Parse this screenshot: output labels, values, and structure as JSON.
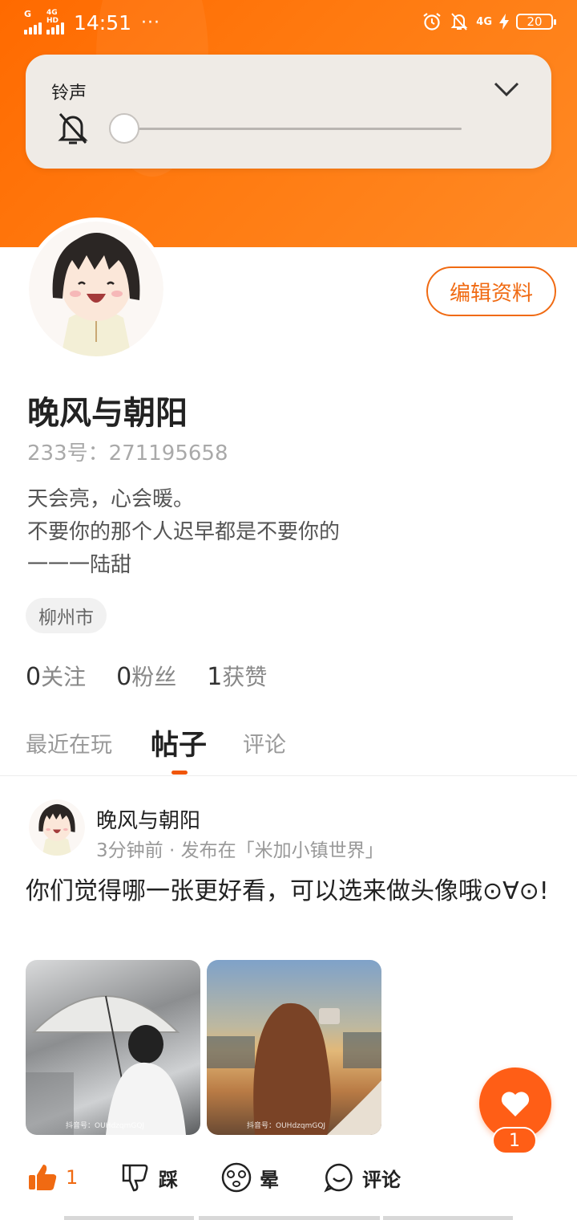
{
  "status_bar": {
    "signal1_tag": "G",
    "signal2_tag": "4G HD",
    "time": "14:51",
    "dots": "···",
    "network_right": "4G",
    "battery": "20"
  },
  "volume_panel": {
    "title": "铃声",
    "level": 0
  },
  "profile": {
    "edit_button": "编辑资料",
    "nickname": "晚风与朝阳",
    "uid_label": "233号：271195658",
    "bio_lines": [
      "天会亮，心会暖。",
      "不要你的那个人迟早都是不要你的",
      "一一一陆甜"
    ],
    "location": "柳州市",
    "stats": [
      {
        "value": "0",
        "label": "关注"
      },
      {
        "value": "0",
        "label": "粉丝"
      },
      {
        "value": "1",
        "label": "获赞"
      }
    ]
  },
  "tabs": [
    {
      "label": "最近在玩",
      "active": false
    },
    {
      "label": "帖子",
      "active": true
    },
    {
      "label": "评论",
      "active": false
    }
  ],
  "post": {
    "author": "晚风与朝阳",
    "meta": "3分钟前 · 发布在「米加小镇世界」",
    "text": "你们觉得哪一张更好看，可以选来做头像哦⊙∀⊙!",
    "images": [
      {
        "watermark": "抖音号：OUHdzqmGQJ"
      },
      {
        "watermark": "抖音号：OUHdzqmGQJ"
      }
    ],
    "actions": {
      "like_count": "1",
      "dislike": "踩",
      "dizzy": "晕",
      "comment": "评论"
    }
  },
  "fab": {
    "count": "1"
  },
  "colors": {
    "accent": "#f06a12",
    "header": "#ff7a10",
    "panel": "#efebe6"
  }
}
